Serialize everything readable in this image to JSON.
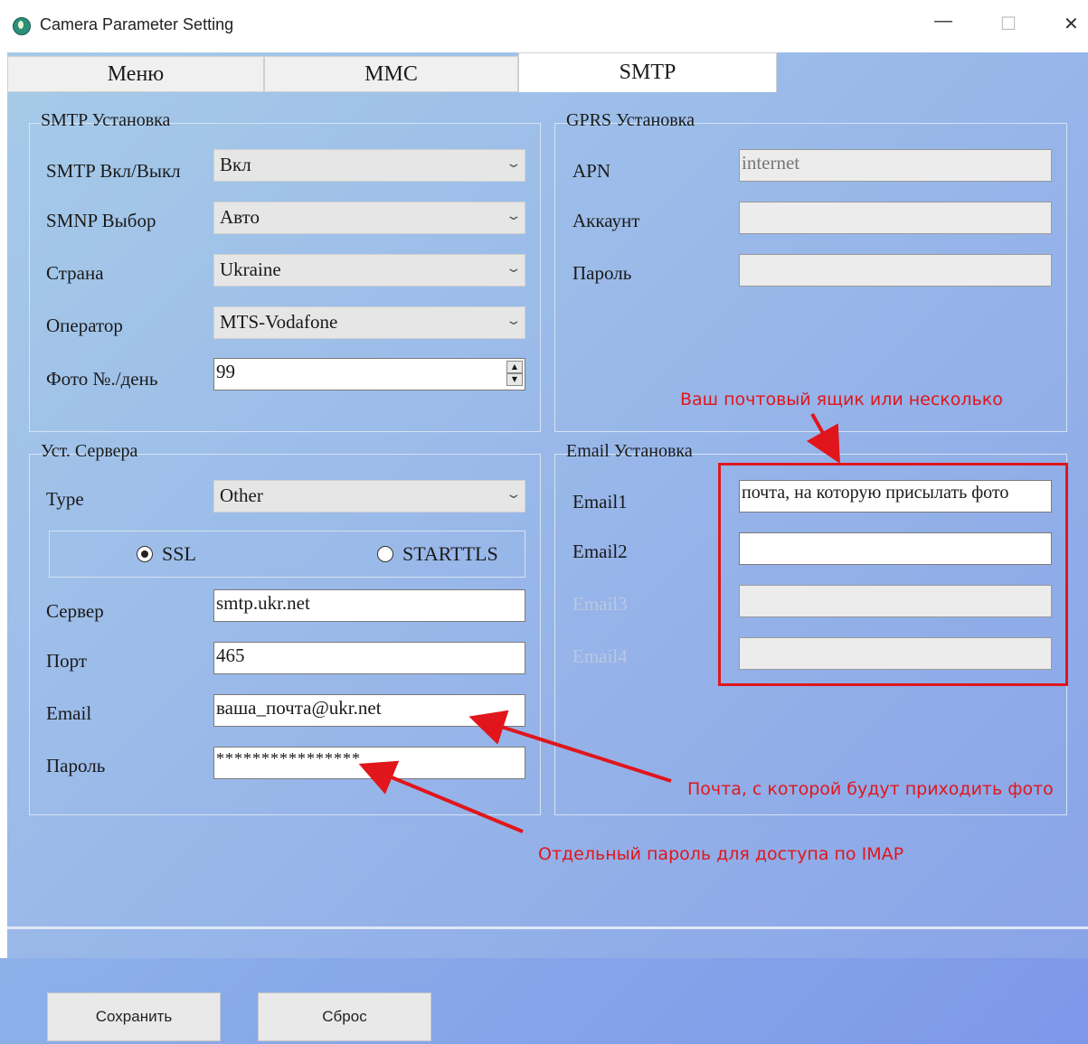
{
  "window": {
    "title": "Camera Parameter Setting",
    "minimize": "—",
    "maximize": "☐",
    "close": "✕"
  },
  "tabs": [
    {
      "label": "Меню"
    },
    {
      "label": "MMC"
    },
    {
      "label": "SMTP"
    }
  ],
  "smtp_group": {
    "title": "SMTP Установка",
    "onoff_label": "SMTP Вкл/Выкл",
    "onoff_value": "Вкл",
    "smnp_label": "SMNP Выбор",
    "smnp_value": "Авто",
    "country_label": "Страна",
    "country_value": "Ukraine",
    "operator_label": "Оператор",
    "operator_value": "MTS-Vodafone",
    "photos_label": "Фото №./день",
    "photos_value": "99"
  },
  "gprs_group": {
    "title": "GPRS Установка",
    "apn_label": "APN",
    "apn_value": "internet",
    "account_label": "Аккаунт",
    "account_value": "",
    "password_label": "Пароль",
    "password_value": ""
  },
  "server_group": {
    "title": "Уст. Сервера",
    "type_label": "Type",
    "type_value": "Other",
    "ssl_label": "SSL",
    "starttls_label": "STARTTLS",
    "server_label": "Сервер",
    "server_value": "smtp.ukr.net",
    "port_label": "Порт",
    "port_value": "465",
    "email_label": "Email",
    "email_value": "ваша_почта@ukr.net",
    "password_label": "Пароль",
    "password_value": "****************"
  },
  "email_group": {
    "title": "Email Установка",
    "email1_label": "Email1",
    "email1_value": "почта, на которую присылать фото",
    "email2_label": "Email2",
    "email2_value": "",
    "email3_label": "Email3",
    "email3_value": "",
    "email4_label": "Email4",
    "email4_value": ""
  },
  "buttons": {
    "save": "Сохранить",
    "reset": "Сброс"
  },
  "annotations": {
    "mailbox_note": "Ваш почтовый ящик или несколько",
    "sender_note": "Почта, с которой будут приходить фото",
    "password_note": "Отдельный пароль для доступа по IMAP",
    "color": "#e0161c"
  }
}
